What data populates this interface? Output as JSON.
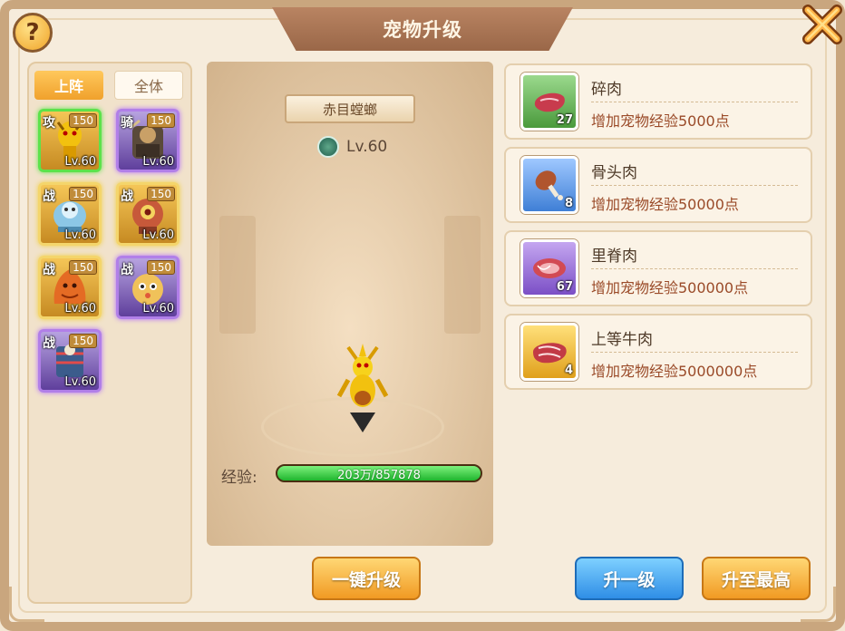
{
  "window": {
    "title": "宠物升级",
    "help_icon": "question-icon",
    "close_icon": "close-x-icon"
  },
  "tabs": [
    {
      "label": "上阵",
      "active": true
    },
    {
      "label": "全体",
      "active": false
    }
  ],
  "pets": [
    {
      "role": "攻",
      "stars": "150",
      "level": "Lv.60",
      "frame": "gold",
      "selected": true
    },
    {
      "role": "骑",
      "stars": "150",
      "level": "Lv.60",
      "frame": "purple",
      "selected": false
    },
    {
      "role": "战",
      "stars": "150",
      "level": "Lv.60",
      "frame": "gold",
      "selected": false
    },
    {
      "role": "战",
      "stars": "150",
      "level": "Lv.60",
      "frame": "gold",
      "selected": false
    },
    {
      "role": "战",
      "stars": "150",
      "level": "Lv.60",
      "frame": "gold",
      "selected": false
    },
    {
      "role": "战",
      "stars": "150",
      "level": "Lv.60",
      "frame": "purple",
      "selected": false
    },
    {
      "role": "战",
      "stars": "150",
      "level": "Lv.60",
      "frame": "purple",
      "selected": false
    }
  ],
  "selected_pet": {
    "name": "赤目螳螂",
    "level": "Lv.60",
    "exp_label": "经验:",
    "exp_text": "203万/857878",
    "exp_progress": 1.0
  },
  "items": [
    {
      "name": "碎肉",
      "desc": "增加宠物经验5000点",
      "count": "27",
      "icon": "raw-meat-icon",
      "rarity_color": "#4a9a3c"
    },
    {
      "name": "骨头肉",
      "desc": "增加宠物经验50000点",
      "count": "8",
      "icon": "drumstick-icon",
      "rarity_color": "#3f7fd6"
    },
    {
      "name": "里脊肉",
      "desc": "增加宠物经验500000点",
      "count": "67",
      "icon": "tenderloin-icon",
      "rarity_color": "#7b4fc6"
    },
    {
      "name": "上等牛肉",
      "desc": "增加宠物经验5000000点",
      "count": "4",
      "icon": "steak-icon",
      "rarity_color": "#e0a01c"
    }
  ],
  "buttons": {
    "one_key": "一键升级",
    "level_one": "升一级",
    "level_max": "升至最高"
  }
}
